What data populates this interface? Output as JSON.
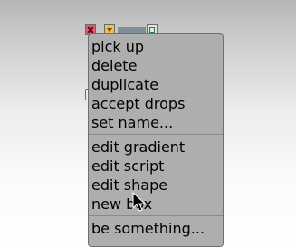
{
  "menu": {
    "items": [
      "pick up",
      "delete",
      "duplicate",
      "accept drops",
      "set name...",
      "edit gradient",
      "edit script",
      "edit shape",
      "new box",
      "be something..."
    ]
  }
}
